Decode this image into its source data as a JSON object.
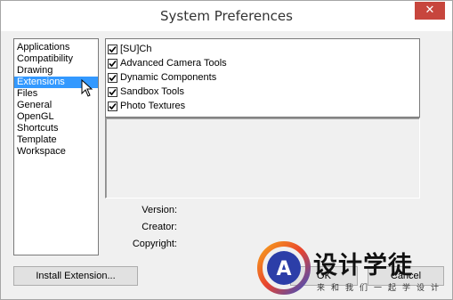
{
  "window": {
    "title": "System Preferences",
    "close_glyph": "✕"
  },
  "categories": [
    {
      "label": "Applications",
      "selected": false
    },
    {
      "label": "Compatibility",
      "selected": false
    },
    {
      "label": "Drawing",
      "selected": false
    },
    {
      "label": "Extensions",
      "selected": true
    },
    {
      "label": "Files",
      "selected": false
    },
    {
      "label": "General",
      "selected": false
    },
    {
      "label": "OpenGL",
      "selected": false
    },
    {
      "label": "Shortcuts",
      "selected": false
    },
    {
      "label": "Template",
      "selected": false
    },
    {
      "label": "Workspace",
      "selected": false
    }
  ],
  "extensions": [
    {
      "label": "[SU]Ch",
      "checked": true
    },
    {
      "label": "Advanced Camera Tools",
      "checked": true
    },
    {
      "label": "Dynamic Components",
      "checked": true
    },
    {
      "label": "Sandbox Tools",
      "checked": true
    },
    {
      "label": "Photo Textures",
      "checked": true
    }
  ],
  "details": {
    "version_label": "Version:",
    "version_value": "",
    "creator_label": "Creator:",
    "creator_value": "",
    "copyright_label": "Copyright:",
    "copyright_value": ""
  },
  "buttons": {
    "install": "Install Extension...",
    "ok": "OK",
    "cancel": "Cancel"
  },
  "watermark": {
    "text": "设计学徒",
    "sub": "来和我们一起学设计",
    "letter": "A"
  },
  "colors": {
    "selection": "#3399ff",
    "close_button": "#c7463d"
  },
  "icons": {
    "close": "close-icon",
    "cursor": "mouse-pointer-icon",
    "check": "checkmark-icon"
  }
}
